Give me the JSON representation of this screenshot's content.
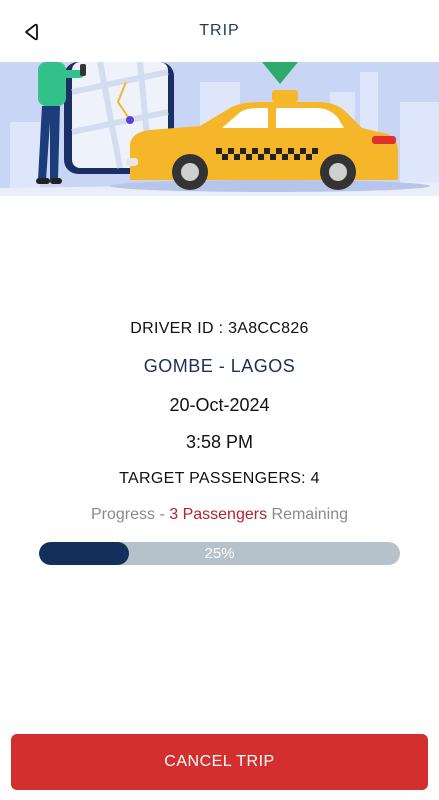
{
  "header": {
    "title": "TRIP",
    "back_icon": "back-arrow-icon"
  },
  "banner": {
    "illustration": "taxi-map-illustration",
    "taxi_color": "#f5b62a",
    "map_pin_color": "#2eaa6a"
  },
  "trip": {
    "driver_id": "DRIVER ID : 3A8CC826",
    "route": "GOMBE - LAGOS",
    "date": "20-Oct-2024",
    "time": "3:58 PM",
    "target_passengers": "TARGET PASSENGERS: 4"
  },
  "progress": {
    "prefix": "Progress - ",
    "highlight": "3 Passengers",
    "suffix": " Remaining",
    "percent_label": "25%",
    "fraction": 0.25
  },
  "actions": {
    "cancel_label": "CANCEL TRIP"
  },
  "colors": {
    "accent_navy": "#13305d",
    "danger_red": "#d32f2f",
    "highlight_red": "#b5232b"
  }
}
